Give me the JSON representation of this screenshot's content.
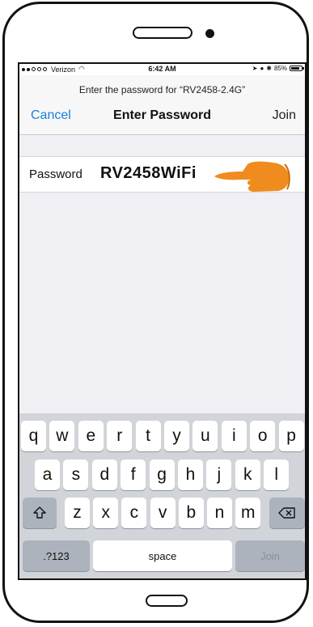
{
  "status_bar": {
    "carrier": "Verizon",
    "time": "6:42 AM",
    "battery": "85%",
    "battery_level": 0.85
  },
  "nav": {
    "prompt": "Enter the password for “RV2458-2.4G”",
    "cancel_label": "Cancel",
    "title": "Enter Password",
    "join_label": "Join"
  },
  "password_field": {
    "label": "Password",
    "value": "RV2458WiFi"
  },
  "keyboard": {
    "row1": [
      "q",
      "w",
      "e",
      "r",
      "t",
      "y",
      "u",
      "i",
      "o",
      "p"
    ],
    "row2": [
      "a",
      "s",
      "d",
      "f",
      "g",
      "h",
      "j",
      "k",
      "l"
    ],
    "row3": [
      "z",
      "x",
      "c",
      "v",
      "b",
      "n",
      "m"
    ],
    "numbers_label": ".?123",
    "space_label": "space",
    "join_label": "Join"
  },
  "colors": {
    "accent": "#1a7fe0",
    "pointer": "#f08c1e"
  }
}
